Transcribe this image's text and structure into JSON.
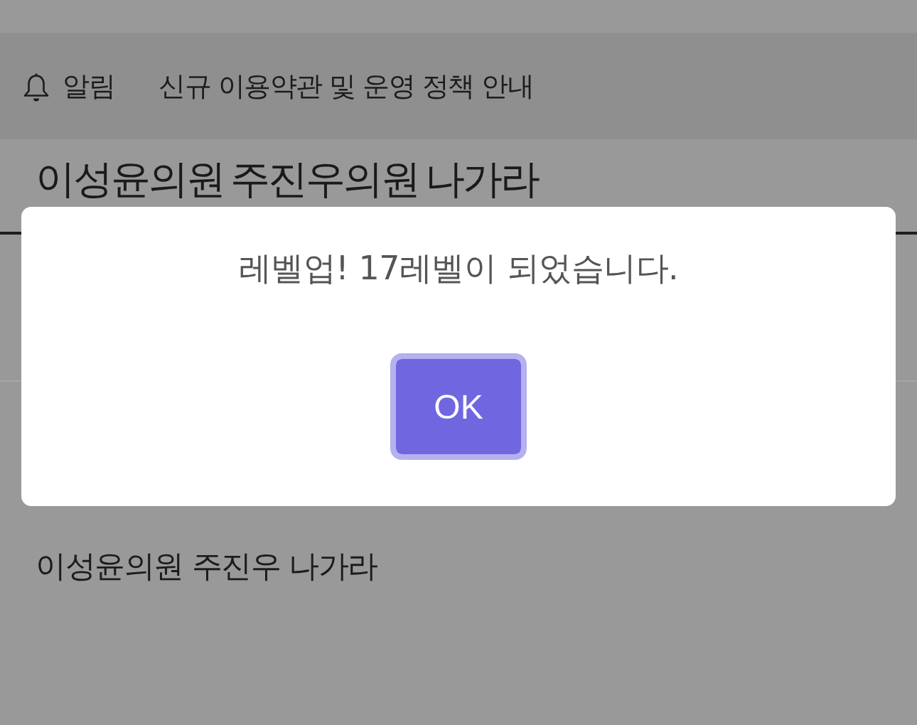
{
  "notice_bar": {
    "label": "알림",
    "message": "신규 이용약관 및 운영 정책 안내"
  },
  "post": {
    "title": "이성윤의원 주진우의원 나가라",
    "body": "이성윤의원 주진우 나가라"
  },
  "dialog": {
    "message": "레벨업! 17레벨이 되었습니다.",
    "button": {
      "label": "OK",
      "focused": true
    }
  }
}
